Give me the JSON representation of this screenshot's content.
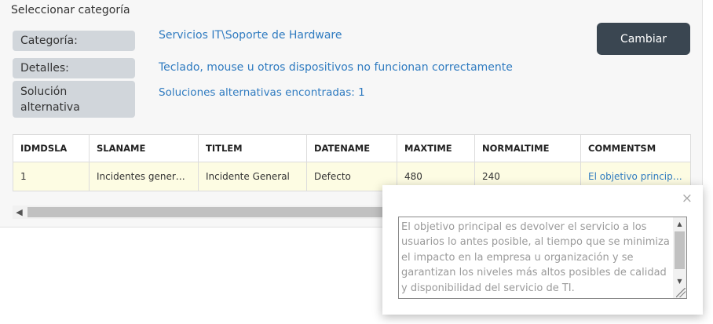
{
  "section": {
    "title": "Seleccionar categoría"
  },
  "fields": [
    {
      "label": "Categoría:",
      "value": "Servicios IT\\Soporte de Hardware"
    },
    {
      "label": "Detalles:",
      "value": "Teclado, mouse u otros dispositivos no funcionan correctamente"
    },
    {
      "label": "Solución alternativa",
      "value": "Soluciones alternativas encontradas: 1"
    }
  ],
  "actions": {
    "change_label": "Cambiar"
  },
  "grid": {
    "columns": [
      "IDMDSLA",
      "SLANAME",
      "TITLEM",
      "DATENAME",
      "MAXTIME",
      "NORMALTIME",
      "COMMENTSM"
    ],
    "rows": [
      [
        "1",
        "Incidentes generales",
        "Incidente General",
        "Defecto",
        "480",
        "240",
        "El objetivo principal es devolver el servicio a los usuarios lo antes posible, al tiempo que se minimiza el impacto en la empresa u organización y se garantizan los niveles más altos posibles de calidad y disponibilidad del servicio de TI."
      ]
    ]
  },
  "popup": {
    "close_symbol": "×",
    "text": "El objetivo principal es devolver el servicio a los usuarios lo antes posible, al tiempo que se minimiza el impacto en la empresa u organización y se garantizan los niveles más altos posibles de calidad y disponibilidad del servicio de TI."
  },
  "icons": {
    "close": "close-icon",
    "scroll_left": "chevron-left-icon",
    "scroll_up": "chevron-up-icon",
    "scroll_down": "chevron-down-icon",
    "resize": "resize-grip-icon"
  },
  "colors": {
    "accent_link": "#2f7bc0",
    "button_bg": "#3a4651",
    "label_bg": "#d1d6db",
    "row_highlight": "#fdfce3"
  }
}
